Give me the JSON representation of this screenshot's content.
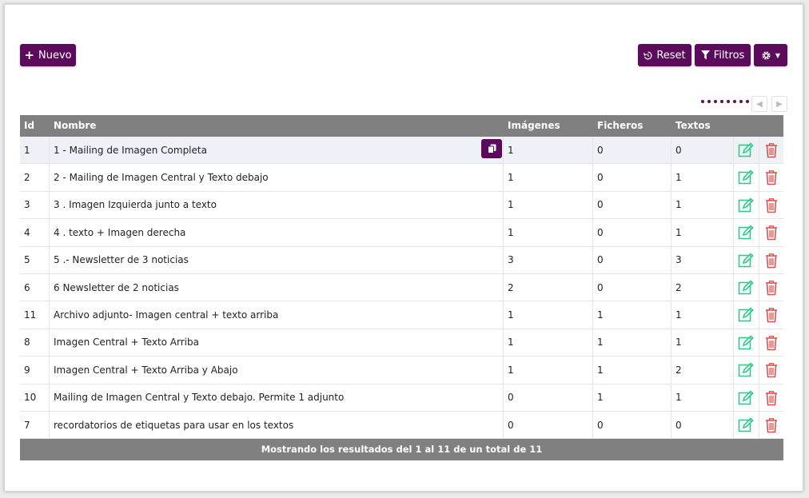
{
  "toolbar": {
    "new_label": "Nuevo",
    "reset_label": "Reset",
    "filters_label": "Filtros"
  },
  "pagination": {
    "dots": 8
  },
  "table": {
    "columns": [
      "Id",
      "Nombre",
      "Imágenes",
      "Ficheros",
      "Textos"
    ],
    "rows": [
      {
        "id": "1",
        "name": "1 - Mailing de Imagen Completa",
        "images": "1",
        "files": "0",
        "texts": "0"
      },
      {
        "id": "2",
        "name": "2 - Mailing de Imagen Central y Texto debajo",
        "images": "1",
        "files": "0",
        "texts": "1"
      },
      {
        "id": "3",
        "name": "3 . Imagen Izquierda junto a texto",
        "images": "1",
        "files": "0",
        "texts": "1"
      },
      {
        "id": "4",
        "name": "4 . texto + Imagen derecha",
        "images": "1",
        "files": "0",
        "texts": "1"
      },
      {
        "id": "5",
        "name": "5 .- Newsletter de 3 noticias",
        "images": "3",
        "files": "0",
        "texts": "3"
      },
      {
        "id": "6",
        "name": "6 Newsletter de 2 noticias",
        "images": "2",
        "files": "0",
        "texts": "2"
      },
      {
        "id": "11",
        "name": "Archivo adjunto- Imagen central + texto arriba",
        "images": "1",
        "files": "1",
        "texts": "1"
      },
      {
        "id": "8",
        "name": "Imagen Central + Texto Arriba",
        "images": "1",
        "files": "1",
        "texts": "1"
      },
      {
        "id": "9",
        "name": "Imagen Central + Texto Arriba y Abajo",
        "images": "1",
        "files": "1",
        "texts": "2"
      },
      {
        "id": "10",
        "name": "Mailing de Imagen Central y Texto debajo. Permite 1 adjunto",
        "images": "0",
        "files": "1",
        "texts": "1"
      },
      {
        "id": "7",
        "name": "recordatorios de etiquetas para usar en los textos",
        "images": "0",
        "files": "0",
        "texts": "0"
      }
    ],
    "footer": "Mostrando los resultados del 1 al 11 de un total de 11"
  },
  "colors": {
    "brand": "#5c0b5c",
    "header_bg": "#808080",
    "edit_icon": "#2ecc8a",
    "delete_icon": "#e0524f",
    "highlight_row": "#eef1f5"
  },
  "icons": {
    "new": "plus-icon",
    "reset": "history-icon",
    "filters": "filter-icon",
    "settings": "gear-icon",
    "copy": "copy-icon",
    "edit": "edit-icon",
    "delete": "trash-icon",
    "prev": "chevron-left-icon",
    "next": "chevron-right-icon"
  }
}
